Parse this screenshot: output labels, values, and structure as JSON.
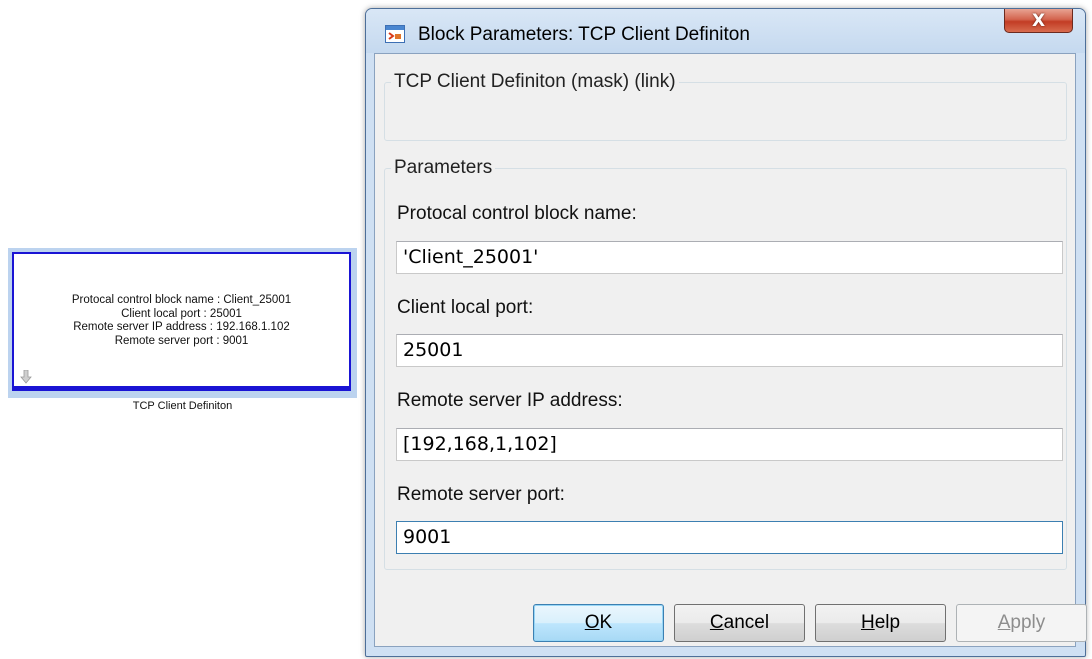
{
  "block": {
    "lines": [
      "Protocal control block name : Client_25001",
      "Client local port : 25001",
      "Remote server IP address : 192.168.1.102",
      "Remote server port : 9001"
    ],
    "caption": "TCP Client Definiton"
  },
  "dialog": {
    "title": "Block Parameters: TCP Client Definiton",
    "close_label": "X",
    "description_group": "TCP Client Definiton (mask) (link)",
    "parameters_group": "Parameters",
    "fields": [
      {
        "label": "Protocal control block name:",
        "value": "'Client_25001'"
      },
      {
        "label": "Client local port:",
        "value": "25001"
      },
      {
        "label": "Remote server IP address:",
        "value": "[192,168,1,102]"
      },
      {
        "label": "Remote server port:",
        "value": "9001"
      }
    ],
    "buttons": {
      "ok": {
        "mnemonic": "O",
        "rest": "K"
      },
      "cancel": {
        "mnemonic": "C",
        "rest": "ancel"
      },
      "help": {
        "mnemonic": "H",
        "rest": "elp"
      },
      "apply": {
        "mnemonic": "A",
        "rest": "pply"
      }
    }
  },
  "colors": {
    "block_border": "#1a14d4",
    "window_frame": "#cfe0f3",
    "close_button": "#c23c24",
    "default_button_border": "#3c7fb1"
  },
  "icons": {
    "title": "simulink-block-icon",
    "port": "input-port-arrow-icon"
  }
}
